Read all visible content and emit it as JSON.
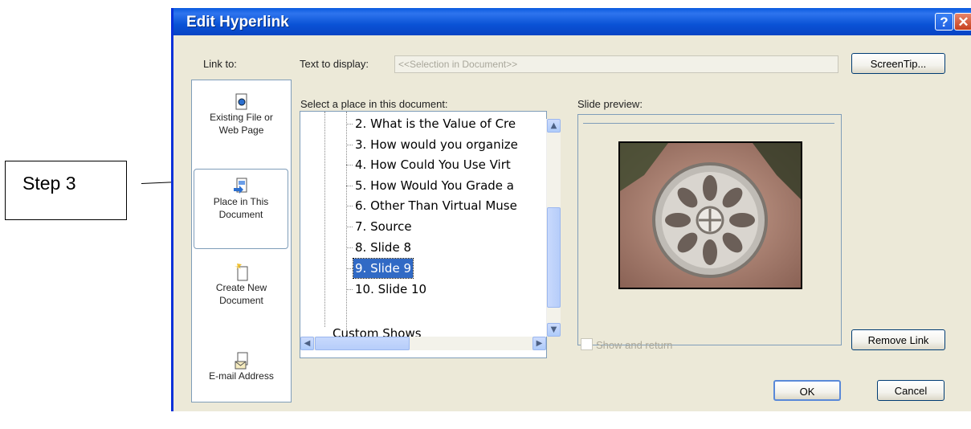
{
  "annotation": {
    "label": "Step 3"
  },
  "dialog": {
    "title": "Edit Hyperlink",
    "help_glyph": "?",
    "close_glyph": "✕",
    "link_to_label": "Link to:",
    "text_to_display_label": "Text to display:",
    "text_to_display_value": "<<Selection in Document>>",
    "screentip_label": "ScreenTip...",
    "select_place_label": "Select a place in this document:",
    "slide_preview_label": "Slide preview:",
    "show_and_return_label": "Show and return",
    "remove_link_label": "Remove Link",
    "ok_label": "OK",
    "cancel_label": "Cancel"
  },
  "link_bar": {
    "items": [
      {
        "label_line1": "Existing File or",
        "label_line2": "Web Page",
        "icon": "existing-file-icon",
        "selected": false
      },
      {
        "label_line1": "Place in This",
        "label_line2": "Document",
        "icon": "place-in-document-icon",
        "selected": true
      },
      {
        "label_line1": "Create New",
        "label_line2": "Document",
        "icon": "new-document-icon",
        "selected": false
      },
      {
        "label_line1": "E-mail Address",
        "label_line2": "",
        "icon": "email-icon",
        "selected": false
      }
    ]
  },
  "tree": {
    "items": [
      {
        "text": "2. What is the Value of Cre",
        "selected": false
      },
      {
        "text": "3. How would you organize",
        "selected": false
      },
      {
        "text": "4. How Could You Use Virt",
        "selected": false
      },
      {
        "text": "5. How Would You Grade a",
        "selected": false
      },
      {
        "text": "6. Other Than Virtual Muse",
        "selected": false
      },
      {
        "text": "7. Source",
        "selected": false
      },
      {
        "text": "8. Slide 8",
        "selected": false
      },
      {
        "text": "9. Slide 9",
        "selected": true
      },
      {
        "text": "10. Slide 10",
        "selected": false
      }
    ],
    "custom_shows": "Custom Shows"
  },
  "colors": {
    "title_bar": "#0a53d6",
    "dialog_bg": "#ece9d8",
    "selection": "#316ac5"
  }
}
